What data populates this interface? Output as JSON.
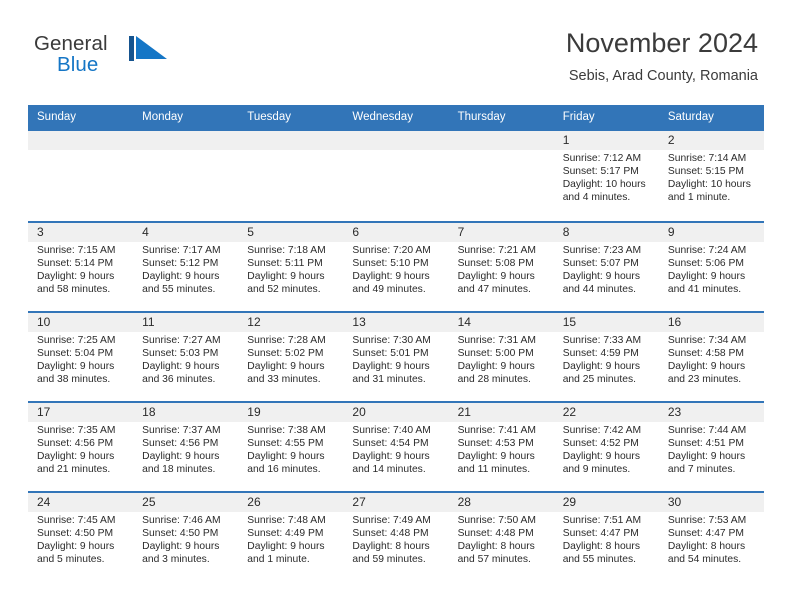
{
  "brand": {
    "name_part1": "General",
    "name_part2": "Blue",
    "mark_icon": "triangle-flag-icon",
    "colors": {
      "dark": "#16548f",
      "light": "#1576c6",
      "text": "#3a3a3a"
    }
  },
  "header": {
    "title": "November 2024",
    "subtitle": "Sebis, Arad County, Romania"
  },
  "theme": {
    "header_blue": "#3275b8",
    "date_band_gray": "#f0f0f0",
    "text": "#2b2b2b"
  },
  "calendar": {
    "weekdays": [
      "Sunday",
      "Monday",
      "Tuesday",
      "Wednesday",
      "Thursday",
      "Friday",
      "Saturday"
    ],
    "weeks": [
      [
        {
          "day": "",
          "sunrise": "",
          "sunset": "",
          "daylight1": "",
          "daylight2": ""
        },
        {
          "day": "",
          "sunrise": "",
          "sunset": "",
          "daylight1": "",
          "daylight2": ""
        },
        {
          "day": "",
          "sunrise": "",
          "sunset": "",
          "daylight1": "",
          "daylight2": ""
        },
        {
          "day": "",
          "sunrise": "",
          "sunset": "",
          "daylight1": "",
          "daylight2": ""
        },
        {
          "day": "",
          "sunrise": "",
          "sunset": "",
          "daylight1": "",
          "daylight2": ""
        },
        {
          "day": "1",
          "sunrise": "Sunrise: 7:12 AM",
          "sunset": "Sunset: 5:17 PM",
          "daylight1": "Daylight: 10 hours",
          "daylight2": "and 4 minutes."
        },
        {
          "day": "2",
          "sunrise": "Sunrise: 7:14 AM",
          "sunset": "Sunset: 5:15 PM",
          "daylight1": "Daylight: 10 hours",
          "daylight2": "and 1 minute."
        }
      ],
      [
        {
          "day": "3",
          "sunrise": "Sunrise: 7:15 AM",
          "sunset": "Sunset: 5:14 PM",
          "daylight1": "Daylight: 9 hours",
          "daylight2": "and 58 minutes."
        },
        {
          "day": "4",
          "sunrise": "Sunrise: 7:17 AM",
          "sunset": "Sunset: 5:12 PM",
          "daylight1": "Daylight: 9 hours",
          "daylight2": "and 55 minutes."
        },
        {
          "day": "5",
          "sunrise": "Sunrise: 7:18 AM",
          "sunset": "Sunset: 5:11 PM",
          "daylight1": "Daylight: 9 hours",
          "daylight2": "and 52 minutes."
        },
        {
          "day": "6",
          "sunrise": "Sunrise: 7:20 AM",
          "sunset": "Sunset: 5:10 PM",
          "daylight1": "Daylight: 9 hours",
          "daylight2": "and 49 minutes."
        },
        {
          "day": "7",
          "sunrise": "Sunrise: 7:21 AM",
          "sunset": "Sunset: 5:08 PM",
          "daylight1": "Daylight: 9 hours",
          "daylight2": "and 47 minutes."
        },
        {
          "day": "8",
          "sunrise": "Sunrise: 7:23 AM",
          "sunset": "Sunset: 5:07 PM",
          "daylight1": "Daylight: 9 hours",
          "daylight2": "and 44 minutes."
        },
        {
          "day": "9",
          "sunrise": "Sunrise: 7:24 AM",
          "sunset": "Sunset: 5:06 PM",
          "daylight1": "Daylight: 9 hours",
          "daylight2": "and 41 minutes."
        }
      ],
      [
        {
          "day": "10",
          "sunrise": "Sunrise: 7:25 AM",
          "sunset": "Sunset: 5:04 PM",
          "daylight1": "Daylight: 9 hours",
          "daylight2": "and 38 minutes."
        },
        {
          "day": "11",
          "sunrise": "Sunrise: 7:27 AM",
          "sunset": "Sunset: 5:03 PM",
          "daylight1": "Daylight: 9 hours",
          "daylight2": "and 36 minutes."
        },
        {
          "day": "12",
          "sunrise": "Sunrise: 7:28 AM",
          "sunset": "Sunset: 5:02 PM",
          "daylight1": "Daylight: 9 hours",
          "daylight2": "and 33 minutes."
        },
        {
          "day": "13",
          "sunrise": "Sunrise: 7:30 AM",
          "sunset": "Sunset: 5:01 PM",
          "daylight1": "Daylight: 9 hours",
          "daylight2": "and 31 minutes."
        },
        {
          "day": "14",
          "sunrise": "Sunrise: 7:31 AM",
          "sunset": "Sunset: 5:00 PM",
          "daylight1": "Daylight: 9 hours",
          "daylight2": "and 28 minutes."
        },
        {
          "day": "15",
          "sunrise": "Sunrise: 7:33 AM",
          "sunset": "Sunset: 4:59 PM",
          "daylight1": "Daylight: 9 hours",
          "daylight2": "and 25 minutes."
        },
        {
          "day": "16",
          "sunrise": "Sunrise: 7:34 AM",
          "sunset": "Sunset: 4:58 PM",
          "daylight1": "Daylight: 9 hours",
          "daylight2": "and 23 minutes."
        }
      ],
      [
        {
          "day": "17",
          "sunrise": "Sunrise: 7:35 AM",
          "sunset": "Sunset: 4:56 PM",
          "daylight1": "Daylight: 9 hours",
          "daylight2": "and 21 minutes."
        },
        {
          "day": "18",
          "sunrise": "Sunrise: 7:37 AM",
          "sunset": "Sunset: 4:56 PM",
          "daylight1": "Daylight: 9 hours",
          "daylight2": "and 18 minutes."
        },
        {
          "day": "19",
          "sunrise": "Sunrise: 7:38 AM",
          "sunset": "Sunset: 4:55 PM",
          "daylight1": "Daylight: 9 hours",
          "daylight2": "and 16 minutes."
        },
        {
          "day": "20",
          "sunrise": "Sunrise: 7:40 AM",
          "sunset": "Sunset: 4:54 PM",
          "daylight1": "Daylight: 9 hours",
          "daylight2": "and 14 minutes."
        },
        {
          "day": "21",
          "sunrise": "Sunrise: 7:41 AM",
          "sunset": "Sunset: 4:53 PM",
          "daylight1": "Daylight: 9 hours",
          "daylight2": "and 11 minutes."
        },
        {
          "day": "22",
          "sunrise": "Sunrise: 7:42 AM",
          "sunset": "Sunset: 4:52 PM",
          "daylight1": "Daylight: 9 hours",
          "daylight2": "and 9 minutes."
        },
        {
          "day": "23",
          "sunrise": "Sunrise: 7:44 AM",
          "sunset": "Sunset: 4:51 PM",
          "daylight1": "Daylight: 9 hours",
          "daylight2": "and 7 minutes."
        }
      ],
      [
        {
          "day": "24",
          "sunrise": "Sunrise: 7:45 AM",
          "sunset": "Sunset: 4:50 PM",
          "daylight1": "Daylight: 9 hours",
          "daylight2": "and 5 minutes."
        },
        {
          "day": "25",
          "sunrise": "Sunrise: 7:46 AM",
          "sunset": "Sunset: 4:50 PM",
          "daylight1": "Daylight: 9 hours",
          "daylight2": "and 3 minutes."
        },
        {
          "day": "26",
          "sunrise": "Sunrise: 7:48 AM",
          "sunset": "Sunset: 4:49 PM",
          "daylight1": "Daylight: 9 hours",
          "daylight2": "and 1 minute."
        },
        {
          "day": "27",
          "sunrise": "Sunrise: 7:49 AM",
          "sunset": "Sunset: 4:48 PM",
          "daylight1": "Daylight: 8 hours",
          "daylight2": "and 59 minutes."
        },
        {
          "day": "28",
          "sunrise": "Sunrise: 7:50 AM",
          "sunset": "Sunset: 4:48 PM",
          "daylight1": "Daylight: 8 hours",
          "daylight2": "and 57 minutes."
        },
        {
          "day": "29",
          "sunrise": "Sunrise: 7:51 AM",
          "sunset": "Sunset: 4:47 PM",
          "daylight1": "Daylight: 8 hours",
          "daylight2": "and 55 minutes."
        },
        {
          "day": "30",
          "sunrise": "Sunrise: 7:53 AM",
          "sunset": "Sunset: 4:47 PM",
          "daylight1": "Daylight: 8 hours",
          "daylight2": "and 54 minutes."
        }
      ]
    ]
  }
}
